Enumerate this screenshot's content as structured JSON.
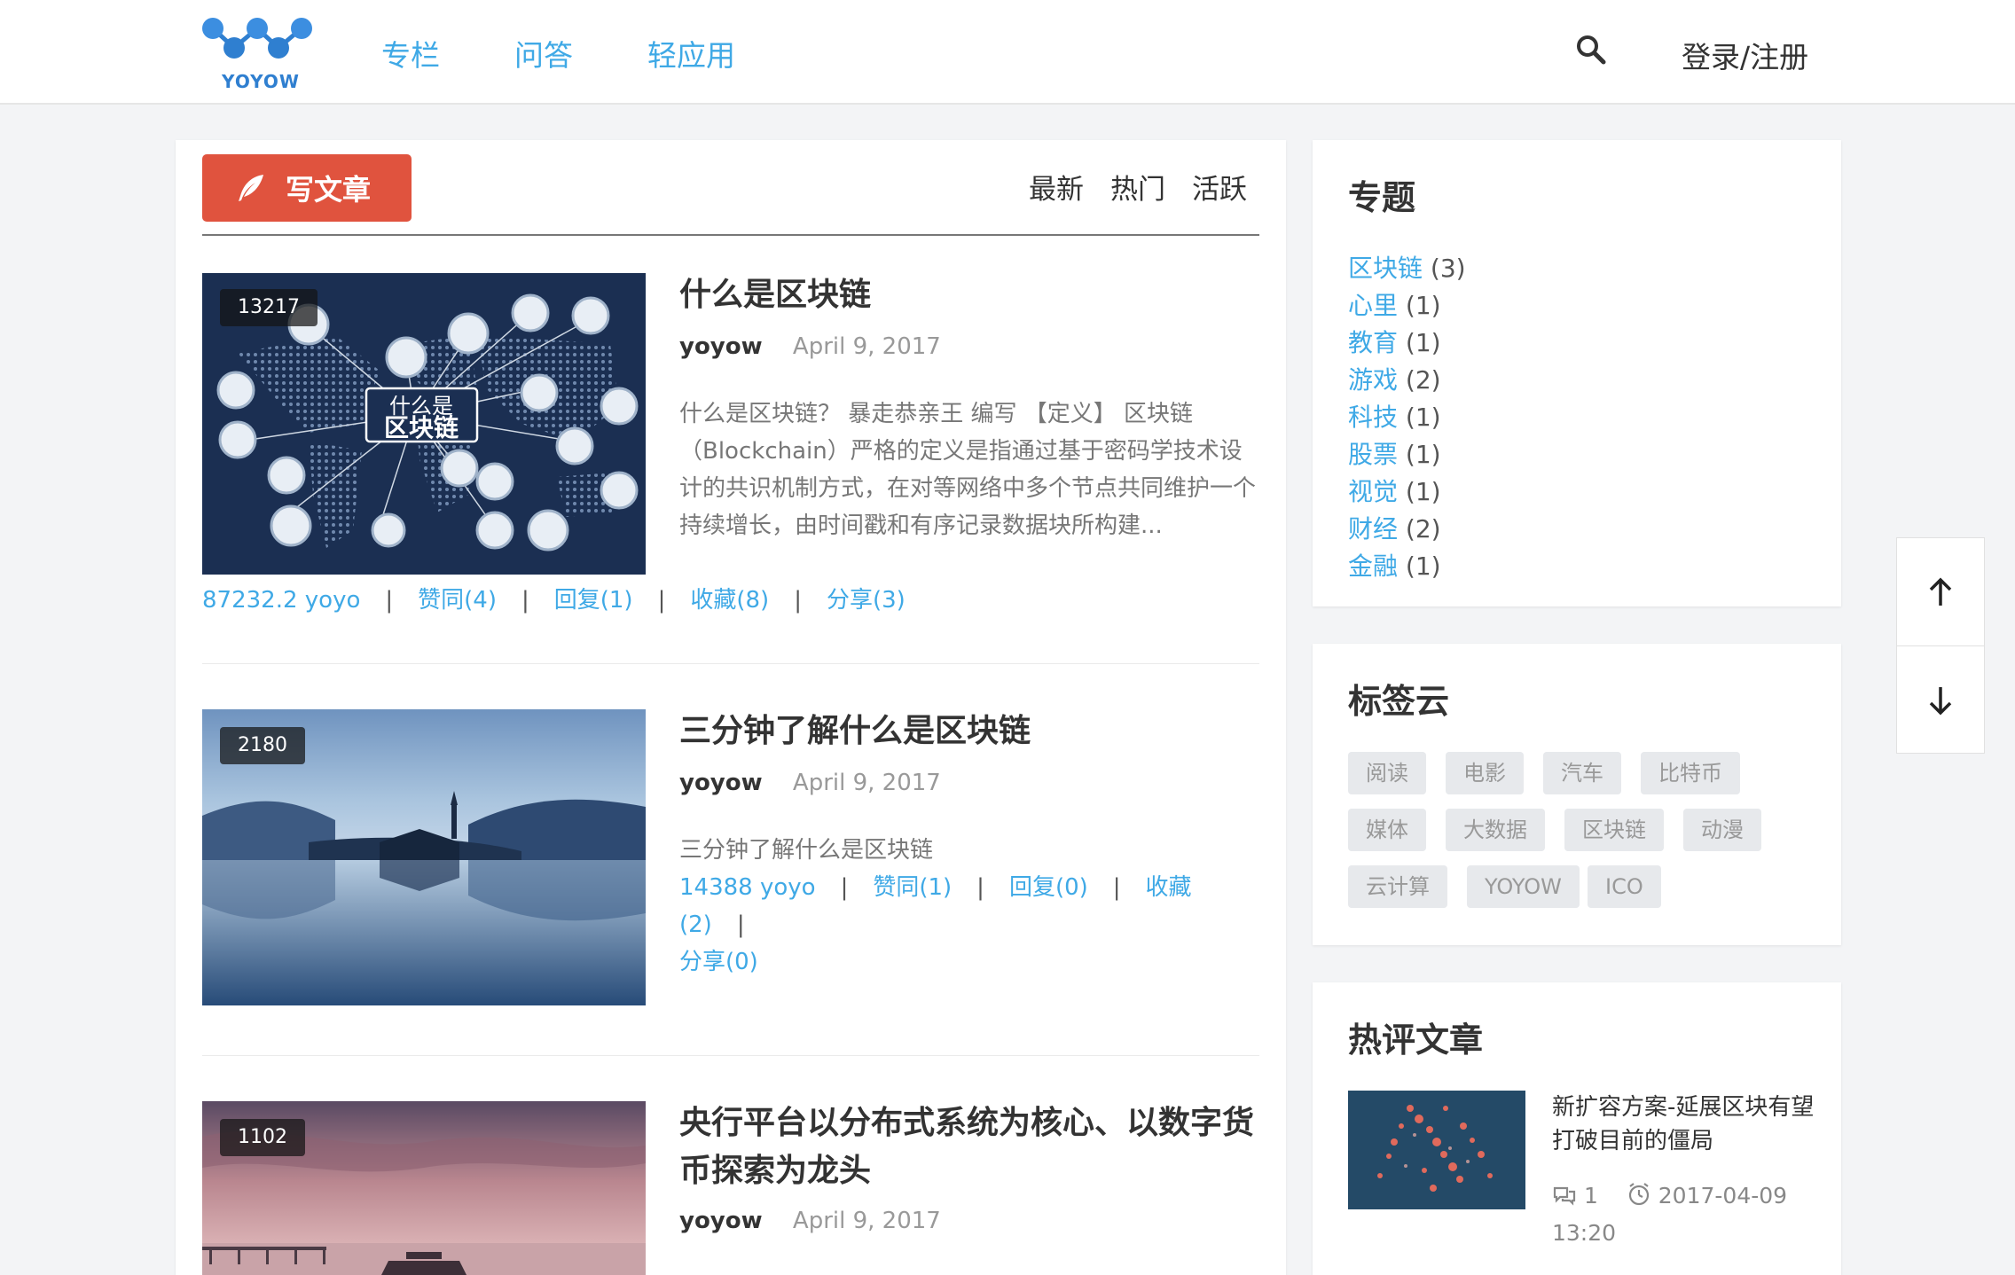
{
  "header": {
    "logo_text": "YOYOW",
    "nav": [
      {
        "label": "专栏"
      },
      {
        "label": "问答"
      },
      {
        "label": "轻应用"
      }
    ],
    "login_label": "登录/注册",
    "search_icon": "search-icon"
  },
  "main": {
    "write_label": "写文章",
    "sort_tabs": [
      "最新",
      "热门",
      "活跃"
    ],
    "articles": [
      {
        "views": "13217",
        "thumb_text_line1": "什么是",
        "thumb_text_line2": "区块链",
        "title": "什么是区块链",
        "author": "yoyow",
        "date": "April 9, 2017",
        "excerpt": "什么是区块链？ 暴走恭亲王 编写 【定义】 区块链（Blockchain）严格的定义是指通过基于密码学技术设计的共识机制方式，在对等网络中多个节点共同维护一个持续增长，由时间戳和有序记录数据块所构建...",
        "stats": {
          "yoyo": "87232.2 yoyo",
          "likes": "赞同(4)",
          "replies": "回复(1)",
          "favorites": "收藏(8)",
          "shares": "分享(3)"
        }
      },
      {
        "views": "2180",
        "title": "三分钟了解什么是区块链",
        "author": "yoyow",
        "date": "April 9, 2017",
        "excerpt": "三分钟了解什么是区块链",
        "stats": {
          "yoyo": "14388 yoyo",
          "likes": "赞同(1)",
          "replies": "回复(0)",
          "favorites": "收藏(2)",
          "shares": "分享(0)"
        }
      },
      {
        "views": "1102",
        "title": "央行平台以分布式系统为核心、以数字货币探索为龙头",
        "author": "yoyow",
        "date": "April 9, 2017"
      }
    ]
  },
  "sidebar": {
    "topics_title": "专题",
    "topics": [
      {
        "name": "区块链",
        "count": "(3)"
      },
      {
        "name": "心里",
        "count": "(1)"
      },
      {
        "name": "教育",
        "count": "(1)"
      },
      {
        "name": "游戏",
        "count": "(2)"
      },
      {
        "name": "科技",
        "count": "(1)"
      },
      {
        "name": "股票",
        "count": "(1)"
      },
      {
        "name": "视觉",
        "count": "(1)"
      },
      {
        "name": "财经",
        "count": "(2)"
      },
      {
        "name": "金融",
        "count": "(1)"
      }
    ],
    "tags_title": "标签云",
    "tags": [
      "阅读",
      "电影",
      "汽车",
      "比特币",
      "媒体",
      "大数据",
      "区块链",
      "动漫",
      "云计算",
      "YOYOW",
      "ICO"
    ],
    "hot_title": "热评文章",
    "hot_articles": [
      {
        "title": "新扩容方案-延展区块有望打破目前的僵局",
        "comments": "1",
        "datetime": "2017-04-09 13:20"
      }
    ]
  },
  "colors": {
    "accent": "#3fa9e6",
    "write_button": "#e0533e",
    "tag_bg": "#e7e9ec"
  }
}
